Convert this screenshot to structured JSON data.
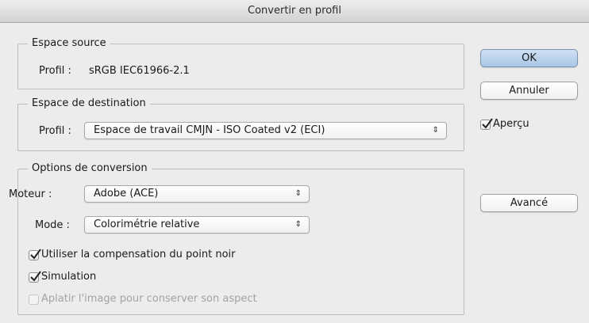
{
  "window": {
    "title": "Convertir en profil"
  },
  "source": {
    "legend": "Espace source",
    "profile_label": "Profil :",
    "profile_value": "sRGB IEC61966-2.1"
  },
  "destination": {
    "legend": "Espace de destination",
    "profile_label": "Profil :",
    "profile_value": "Espace de travail CMJN - ISO Coated v2 (ECI)"
  },
  "options": {
    "legend": "Options de conversion",
    "engine_label": "Moteur :",
    "engine_value": "Adobe (ACE)",
    "mode_label": "Mode :",
    "mode_value": "Colorimétrie relative",
    "black_point_label": "Utiliser la compensation du point noir",
    "black_point_checked": true,
    "simulation_label": "Simulation",
    "simulation_checked": true,
    "flatten_label": "Aplatir l'image pour conserver son aspect",
    "flatten_checked": false,
    "flatten_enabled": false
  },
  "buttons": {
    "ok": "OK",
    "cancel": "Annuler",
    "advanced": "Avancé"
  },
  "preview": {
    "label": "Aperçu",
    "checked": true
  },
  "icons": {
    "select_arrow": "up-down-chevron-icon",
    "checkmark": "checkmark-icon"
  }
}
